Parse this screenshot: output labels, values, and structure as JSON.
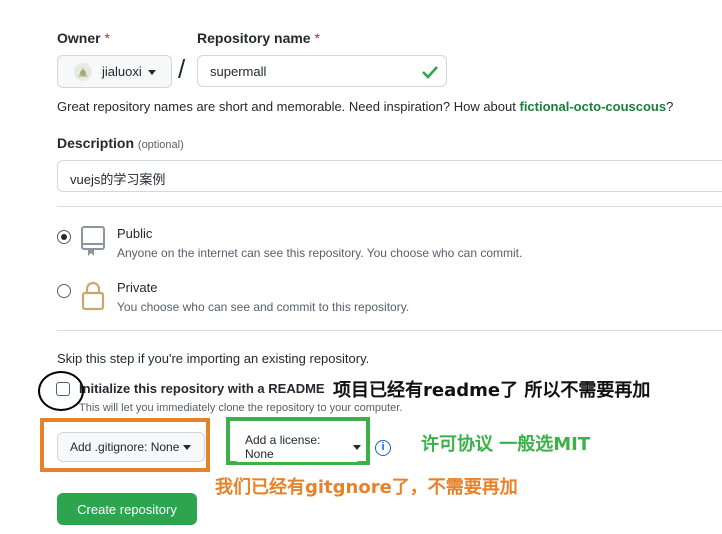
{
  "owner": {
    "label": "Owner",
    "required": "*",
    "value": "jialuoxi"
  },
  "separator": "/",
  "repo": {
    "label": "Repository name",
    "required": "*",
    "value": "supermall"
  },
  "suggestion": {
    "text": "Great repository names are short and memorable. Need inspiration? How about",
    "name": "fictional-octo-couscous",
    "suffix": "?"
  },
  "description": {
    "label": "Description",
    "optional": "(optional)",
    "value": "vuejs的学习案例"
  },
  "visibility": {
    "public": {
      "title": "Public",
      "desc": "Anyone on the internet can see this repository. You choose who can commit.",
      "selected": true
    },
    "private": {
      "title": "Private",
      "desc": "You choose who can see and commit to this repository.",
      "selected": false
    }
  },
  "skip_text": "Skip this step if you're importing an existing repository.",
  "init": {
    "title": "Initialize this repository with a README",
    "desc": "This will let you immediately clone the repository to your computer."
  },
  "gitignore_button": "Add .gitignore: None",
  "license_button": "Add a license: None",
  "info_icon": "i",
  "create_button": "Create repository",
  "annotations": {
    "readme": "项目已经有readme了 所以不需要再加",
    "license": "许可协议 一般选MIT",
    "gitignore": "我们已经有gitgnore了，不需要再加"
  },
  "colors": {
    "green": "#2da44e",
    "annot_green": "#3cb14a",
    "annot_orange": "#e8822a",
    "link_green": "#1a7f37"
  }
}
